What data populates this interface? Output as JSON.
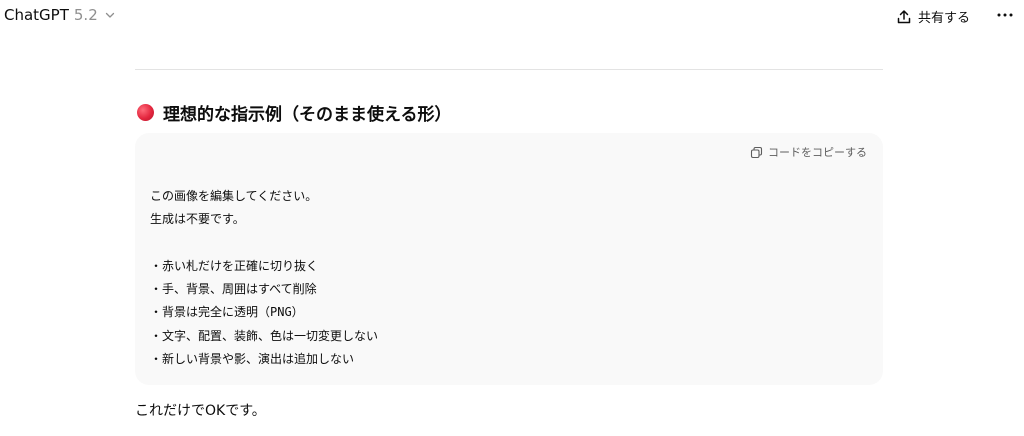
{
  "header": {
    "model_name": "ChatGPT",
    "model_version": "5.2",
    "share_label": "共有する"
  },
  "message": {
    "heading": "理想的な指示例（そのまま使える形）",
    "code_block": {
      "copy_label": "コードをコピーする",
      "lines": [
        "この画像を編集してください。",
        "生成は不要です。",
        "",
        "・赤い札だけを正確に切り抜く",
        "・手、背景、周囲はすべて削除",
        "・背景は完全に透明（PNG）",
        "・文字、配置、装飾、色は一切変更しない",
        "・新しい背景や影、演出は追加しない"
      ]
    },
    "closing_text": "これだけでOKです。"
  },
  "colors": {
    "heading_dot": "#e3263e",
    "code_background": "#f9f9f9",
    "divider": "#e3e3e3"
  },
  "icons": [
    "chevron-down-icon",
    "share-icon",
    "more-icon",
    "copy-icon",
    "red-circle-icon"
  ]
}
